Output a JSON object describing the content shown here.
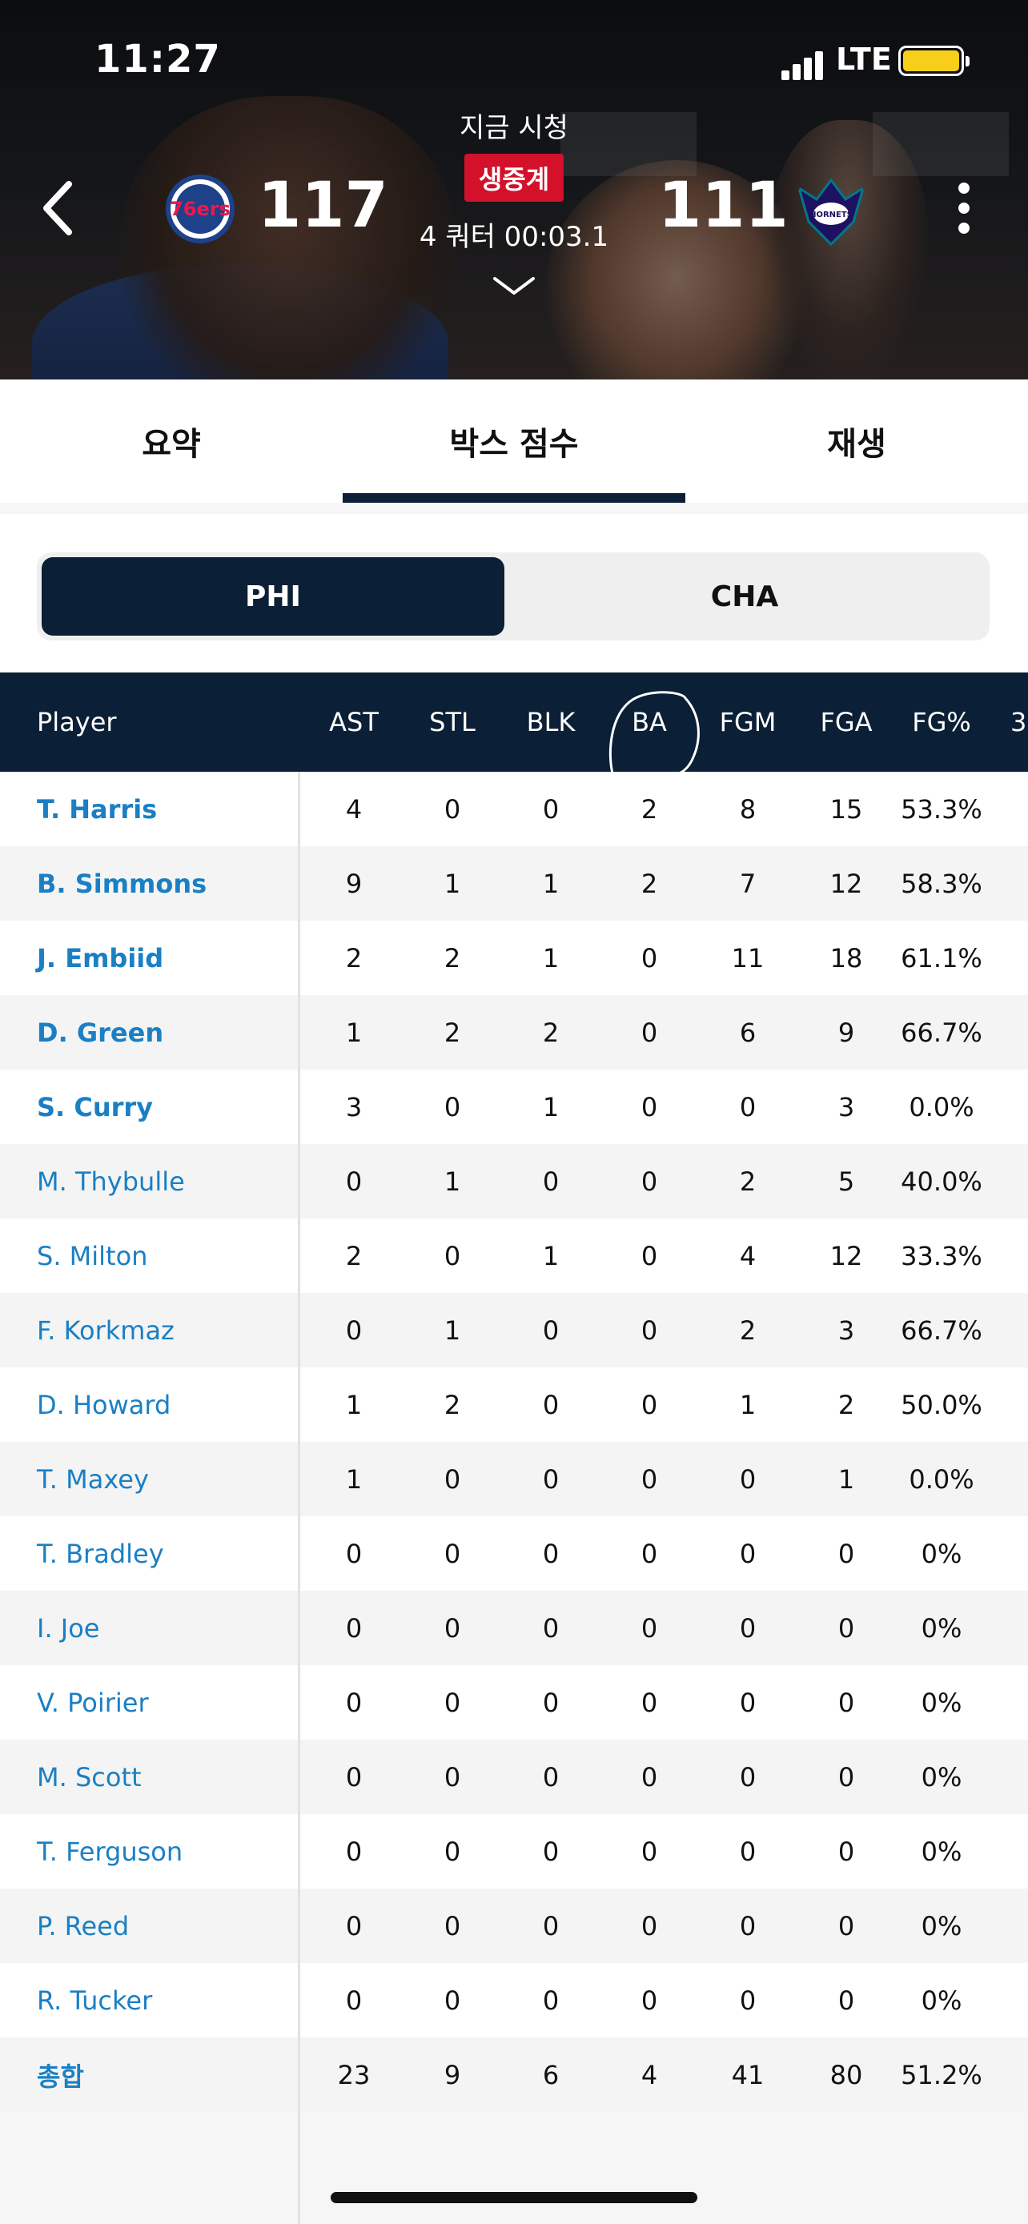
{
  "status_bar": {
    "time": "11:27",
    "network": "LTE"
  },
  "header": {
    "watch_label": "지금 시청",
    "live_badge": "생중계",
    "game_clock": "4 쿼터 00:03.1",
    "home_team": {
      "abbr": "PHI",
      "score": "117",
      "logo_text": "76ers"
    },
    "away_team": {
      "abbr": "CHA",
      "score": "111",
      "logo_text": "HORNETS"
    }
  },
  "tabs": [
    {
      "label": "요약",
      "active": false
    },
    {
      "label": "박스 점수",
      "active": true
    },
    {
      "label": "재생",
      "active": false
    }
  ],
  "team_toggle": {
    "active": "PHI",
    "inactive": "CHA"
  },
  "table": {
    "columns": [
      "Player",
      "AST",
      "STL",
      "BLK",
      "BA",
      "FGM",
      "FGA",
      "FG%",
      "3"
    ],
    "rows": [
      {
        "name": "T. Harris",
        "starter": true,
        "stats": [
          "4",
          "0",
          "0",
          "2",
          "8",
          "15",
          "53.3%"
        ]
      },
      {
        "name": "B. Simmons",
        "starter": true,
        "stats": [
          "9",
          "1",
          "1",
          "2",
          "7",
          "12",
          "58.3%"
        ]
      },
      {
        "name": "J. Embiid",
        "starter": true,
        "stats": [
          "2",
          "2",
          "1",
          "0",
          "11",
          "18",
          "61.1%"
        ]
      },
      {
        "name": "D. Green",
        "starter": true,
        "stats": [
          "1",
          "2",
          "2",
          "0",
          "6",
          "9",
          "66.7%"
        ]
      },
      {
        "name": "S. Curry",
        "starter": true,
        "stats": [
          "3",
          "0",
          "1",
          "0",
          "0",
          "3",
          "0.0%"
        ]
      },
      {
        "name": "M. Thybulle",
        "starter": false,
        "stats": [
          "0",
          "1",
          "0",
          "0",
          "2",
          "5",
          "40.0%"
        ]
      },
      {
        "name": "S. Milton",
        "starter": false,
        "stats": [
          "2",
          "0",
          "1",
          "0",
          "4",
          "12",
          "33.3%"
        ]
      },
      {
        "name": "F. Korkmaz",
        "starter": false,
        "stats": [
          "0",
          "1",
          "0",
          "0",
          "2",
          "3",
          "66.7%"
        ]
      },
      {
        "name": "D. Howard",
        "starter": false,
        "stats": [
          "1",
          "2",
          "0",
          "0",
          "1",
          "2",
          "50.0%"
        ]
      },
      {
        "name": "T. Maxey",
        "starter": false,
        "stats": [
          "1",
          "0",
          "0",
          "0",
          "0",
          "1",
          "0.0%"
        ]
      },
      {
        "name": "T. Bradley",
        "starter": false,
        "stats": [
          "0",
          "0",
          "0",
          "0",
          "0",
          "0",
          "0%"
        ]
      },
      {
        "name": "I. Joe",
        "starter": false,
        "stats": [
          "0",
          "0",
          "0",
          "0",
          "0",
          "0",
          "0%"
        ]
      },
      {
        "name": "V. Poirier",
        "starter": false,
        "stats": [
          "0",
          "0",
          "0",
          "0",
          "0",
          "0",
          "0%"
        ]
      },
      {
        "name": "M. Scott",
        "starter": false,
        "stats": [
          "0",
          "0",
          "0",
          "0",
          "0",
          "0",
          "0%"
        ]
      },
      {
        "name": "T. Ferguson",
        "starter": false,
        "stats": [
          "0",
          "0",
          "0",
          "0",
          "0",
          "0",
          "0%"
        ]
      },
      {
        "name": "P. Reed",
        "starter": false,
        "stats": [
          "0",
          "0",
          "0",
          "0",
          "0",
          "0",
          "0%"
        ]
      },
      {
        "name": "R. Tucker",
        "starter": false,
        "stats": [
          "0",
          "0",
          "0",
          "0",
          "0",
          "0",
          "0%"
        ]
      }
    ],
    "total": {
      "name": "총합",
      "stats": [
        "23",
        "9",
        "6",
        "4",
        "41",
        "80",
        "51.2%"
      ]
    }
  },
  "colors": {
    "navy": "#0b1f36",
    "live_red": "#d3112a",
    "link_blue": "#1a7fc4"
  }
}
